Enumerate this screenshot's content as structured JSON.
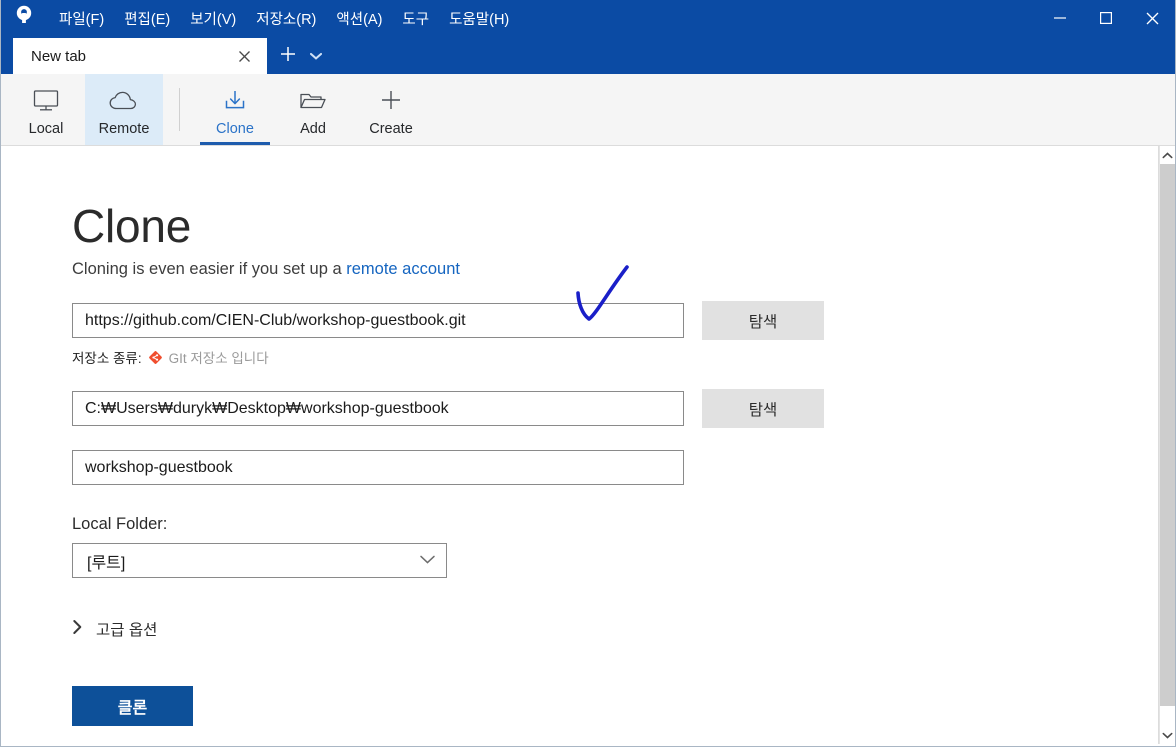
{
  "window": {
    "app_logo_icon": "sourcetree-keyhole-icon",
    "menu": [
      {
        "label": "파일(F)"
      },
      {
        "label": "편집(E)"
      },
      {
        "label": "보기(V)"
      },
      {
        "label": "저장소(R)"
      },
      {
        "label": "액션(A)"
      },
      {
        "label": "도구"
      },
      {
        "label": "도움말(H)"
      }
    ],
    "controls": {
      "minimize_icon": "minimize-icon",
      "maximize_icon": "maximize-icon",
      "close_icon": "close-icon"
    },
    "titlebar_color": "#0b4ba4"
  },
  "tabs": {
    "items": [
      {
        "label": "New tab",
        "close_icon": "close-icon",
        "active": true
      }
    ],
    "new_tab_icon": "plus-icon",
    "dropdown_icon": "chevron-down-icon"
  },
  "toolbar": {
    "groups": [
      {
        "buttons": [
          {
            "label": "Local",
            "icon": "monitor-icon",
            "selected": false,
            "highlighted": false
          },
          {
            "label": "Remote",
            "icon": "cloud-icon",
            "selected": false,
            "highlighted": true
          }
        ]
      },
      {
        "buttons": [
          {
            "label": "Clone",
            "icon": "download-tray-icon",
            "selected": true,
            "highlighted": false
          },
          {
            "label": "Add",
            "icon": "folder-icon",
            "selected": false,
            "highlighted": false
          },
          {
            "label": "Create",
            "icon": "plus-icon",
            "selected": false,
            "highlighted": false
          }
        ]
      }
    ],
    "accent_color": "#1e5cad",
    "selected_text_color": "#2b73c8",
    "highlight_bg": "#dcebf8"
  },
  "page": {
    "title": "Clone",
    "subtitle_prefix": "Cloning is even easier if you set up a ",
    "subtitle_link": "remote account",
    "link_color": "#1565c0",
    "source_url": {
      "value": "https://github.com/CIEN-Club/workshop-guestbook.git",
      "browse_label": "탐색"
    },
    "repo_type": {
      "label": "저장소 종류:",
      "icon": "git-diamond-icon",
      "icon_color": "#f04e2e",
      "value": "GIt 저장소 입니다"
    },
    "destination_path": {
      "value": "C:₩Users₩duryk₩Desktop₩workshop-guestbook",
      "browse_label": "탐색"
    },
    "name_field": {
      "value": "workshop-guestbook"
    },
    "local_folder": {
      "label": "Local Folder:",
      "selected": "[루트]",
      "chevron_icon": "chevron-down-icon"
    },
    "advanced_options": {
      "label": "고급 옵션",
      "chevron_icon": "chevron-right-icon",
      "expanded": false
    },
    "clone_button": {
      "label": "클론",
      "color": "#0d5099"
    },
    "annotation": {
      "shape": "handdrawn-checkmark",
      "color": "#1a1fc8"
    }
  },
  "scrollbar": {
    "up_icon": "chevron-up-icon",
    "down_icon": "chevron-down-icon",
    "thumb_color": "#cdcdcd"
  }
}
